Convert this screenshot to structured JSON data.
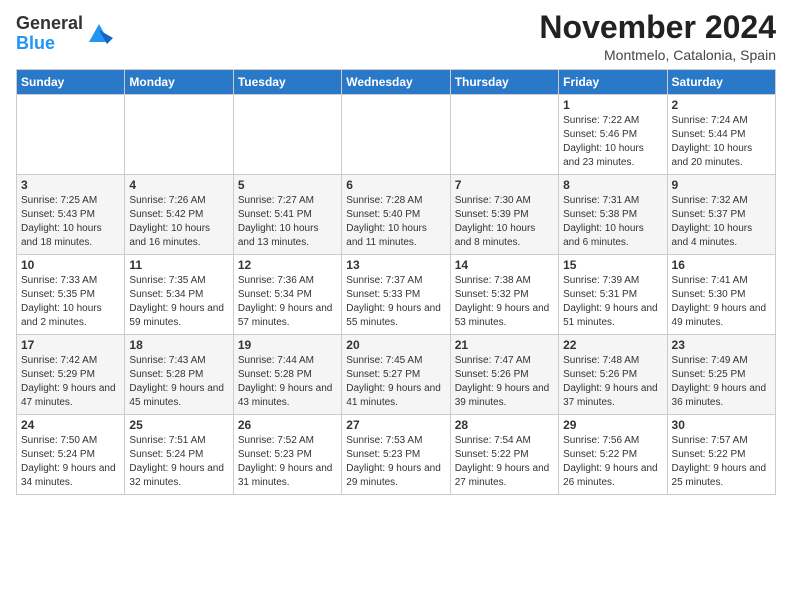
{
  "logo": {
    "general": "General",
    "blue": "Blue"
  },
  "header": {
    "month": "November 2024",
    "location": "Montmelo, Catalonia, Spain"
  },
  "weekdays": [
    "Sunday",
    "Monday",
    "Tuesday",
    "Wednesday",
    "Thursday",
    "Friday",
    "Saturday"
  ],
  "weeks": [
    [
      {
        "day": "",
        "sunrise": "",
        "sunset": "",
        "daylight": ""
      },
      {
        "day": "",
        "sunrise": "",
        "sunset": "",
        "daylight": ""
      },
      {
        "day": "",
        "sunrise": "",
        "sunset": "",
        "daylight": ""
      },
      {
        "day": "",
        "sunrise": "",
        "sunset": "",
        "daylight": ""
      },
      {
        "day": "",
        "sunrise": "",
        "sunset": "",
        "daylight": ""
      },
      {
        "day": "1",
        "sunrise": "Sunrise: 7:22 AM",
        "sunset": "Sunset: 5:46 PM",
        "daylight": "Daylight: 10 hours and 23 minutes."
      },
      {
        "day": "2",
        "sunrise": "Sunrise: 7:24 AM",
        "sunset": "Sunset: 5:44 PM",
        "daylight": "Daylight: 10 hours and 20 minutes."
      }
    ],
    [
      {
        "day": "3",
        "sunrise": "Sunrise: 7:25 AM",
        "sunset": "Sunset: 5:43 PM",
        "daylight": "Daylight: 10 hours and 18 minutes."
      },
      {
        "day": "4",
        "sunrise": "Sunrise: 7:26 AM",
        "sunset": "Sunset: 5:42 PM",
        "daylight": "Daylight: 10 hours and 16 minutes."
      },
      {
        "day": "5",
        "sunrise": "Sunrise: 7:27 AM",
        "sunset": "Sunset: 5:41 PM",
        "daylight": "Daylight: 10 hours and 13 minutes."
      },
      {
        "day": "6",
        "sunrise": "Sunrise: 7:28 AM",
        "sunset": "Sunset: 5:40 PM",
        "daylight": "Daylight: 10 hours and 11 minutes."
      },
      {
        "day": "7",
        "sunrise": "Sunrise: 7:30 AM",
        "sunset": "Sunset: 5:39 PM",
        "daylight": "Daylight: 10 hours and 8 minutes."
      },
      {
        "day": "8",
        "sunrise": "Sunrise: 7:31 AM",
        "sunset": "Sunset: 5:38 PM",
        "daylight": "Daylight: 10 hours and 6 minutes."
      },
      {
        "day": "9",
        "sunrise": "Sunrise: 7:32 AM",
        "sunset": "Sunset: 5:37 PM",
        "daylight": "Daylight: 10 hours and 4 minutes."
      }
    ],
    [
      {
        "day": "10",
        "sunrise": "Sunrise: 7:33 AM",
        "sunset": "Sunset: 5:35 PM",
        "daylight": "Daylight: 10 hours and 2 minutes."
      },
      {
        "day": "11",
        "sunrise": "Sunrise: 7:35 AM",
        "sunset": "Sunset: 5:34 PM",
        "daylight": "Daylight: 9 hours and 59 minutes."
      },
      {
        "day": "12",
        "sunrise": "Sunrise: 7:36 AM",
        "sunset": "Sunset: 5:34 PM",
        "daylight": "Daylight: 9 hours and 57 minutes."
      },
      {
        "day": "13",
        "sunrise": "Sunrise: 7:37 AM",
        "sunset": "Sunset: 5:33 PM",
        "daylight": "Daylight: 9 hours and 55 minutes."
      },
      {
        "day": "14",
        "sunrise": "Sunrise: 7:38 AM",
        "sunset": "Sunset: 5:32 PM",
        "daylight": "Daylight: 9 hours and 53 minutes."
      },
      {
        "day": "15",
        "sunrise": "Sunrise: 7:39 AM",
        "sunset": "Sunset: 5:31 PM",
        "daylight": "Daylight: 9 hours and 51 minutes."
      },
      {
        "day": "16",
        "sunrise": "Sunrise: 7:41 AM",
        "sunset": "Sunset: 5:30 PM",
        "daylight": "Daylight: 9 hours and 49 minutes."
      }
    ],
    [
      {
        "day": "17",
        "sunrise": "Sunrise: 7:42 AM",
        "sunset": "Sunset: 5:29 PM",
        "daylight": "Daylight: 9 hours and 47 minutes."
      },
      {
        "day": "18",
        "sunrise": "Sunrise: 7:43 AM",
        "sunset": "Sunset: 5:28 PM",
        "daylight": "Daylight: 9 hours and 45 minutes."
      },
      {
        "day": "19",
        "sunrise": "Sunrise: 7:44 AM",
        "sunset": "Sunset: 5:28 PM",
        "daylight": "Daylight: 9 hours and 43 minutes."
      },
      {
        "day": "20",
        "sunrise": "Sunrise: 7:45 AM",
        "sunset": "Sunset: 5:27 PM",
        "daylight": "Daylight: 9 hours and 41 minutes."
      },
      {
        "day": "21",
        "sunrise": "Sunrise: 7:47 AM",
        "sunset": "Sunset: 5:26 PM",
        "daylight": "Daylight: 9 hours and 39 minutes."
      },
      {
        "day": "22",
        "sunrise": "Sunrise: 7:48 AM",
        "sunset": "Sunset: 5:26 PM",
        "daylight": "Daylight: 9 hours and 37 minutes."
      },
      {
        "day": "23",
        "sunrise": "Sunrise: 7:49 AM",
        "sunset": "Sunset: 5:25 PM",
        "daylight": "Daylight: 9 hours and 36 minutes."
      }
    ],
    [
      {
        "day": "24",
        "sunrise": "Sunrise: 7:50 AM",
        "sunset": "Sunset: 5:24 PM",
        "daylight": "Daylight: 9 hours and 34 minutes."
      },
      {
        "day": "25",
        "sunrise": "Sunrise: 7:51 AM",
        "sunset": "Sunset: 5:24 PM",
        "daylight": "Daylight: 9 hours and 32 minutes."
      },
      {
        "day": "26",
        "sunrise": "Sunrise: 7:52 AM",
        "sunset": "Sunset: 5:23 PM",
        "daylight": "Daylight: 9 hours and 31 minutes."
      },
      {
        "day": "27",
        "sunrise": "Sunrise: 7:53 AM",
        "sunset": "Sunset: 5:23 PM",
        "daylight": "Daylight: 9 hours and 29 minutes."
      },
      {
        "day": "28",
        "sunrise": "Sunrise: 7:54 AM",
        "sunset": "Sunset: 5:22 PM",
        "daylight": "Daylight: 9 hours and 27 minutes."
      },
      {
        "day": "29",
        "sunrise": "Sunrise: 7:56 AM",
        "sunset": "Sunset: 5:22 PM",
        "daylight": "Daylight: 9 hours and 26 minutes."
      },
      {
        "day": "30",
        "sunrise": "Sunrise: 7:57 AM",
        "sunset": "Sunset: 5:22 PM",
        "daylight": "Daylight: 9 hours and 25 minutes."
      }
    ]
  ]
}
